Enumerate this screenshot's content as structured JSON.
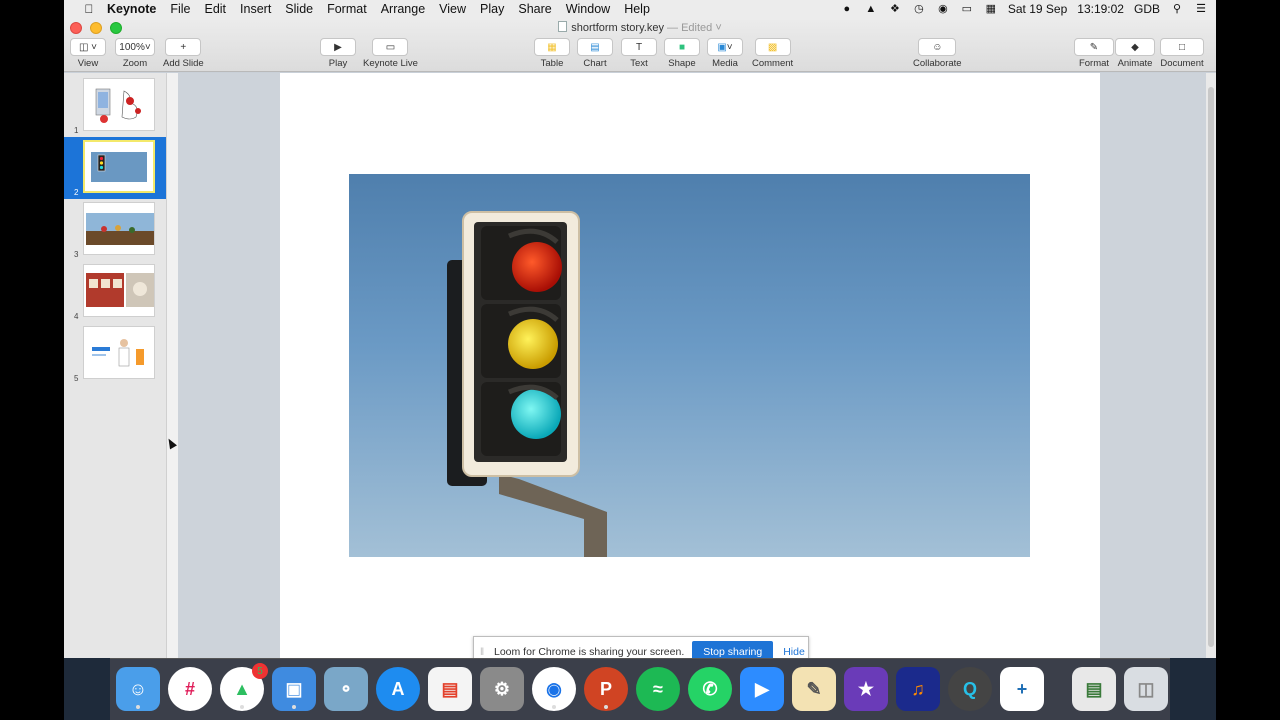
{
  "menubar": {
    "app": "Keynote",
    "items": [
      "File",
      "Edit",
      "Insert",
      "Slide",
      "Format",
      "Arrange",
      "View",
      "Play",
      "Share",
      "Window",
      "Help"
    ],
    "date": "Sat 19 Sep",
    "time": "13:19:02",
    "currency": "GDB"
  },
  "window": {
    "title": "shortform story.key",
    "status": "Edited"
  },
  "toolbar": {
    "view": "View",
    "zoom_value": "100%",
    "zoom": "Zoom",
    "add_slide": "Add Slide",
    "play": "Play",
    "keynote_live": "Keynote Live",
    "table": "Table",
    "chart": "Chart",
    "text": "Text",
    "shape": "Shape",
    "media": "Media",
    "comment": "Comment",
    "collaborate": "Collaborate",
    "format": "Format",
    "animate": "Animate",
    "document": "Document"
  },
  "slides": [
    {
      "num": "1"
    },
    {
      "num": "2"
    },
    {
      "num": "3"
    },
    {
      "num": "4"
    },
    {
      "num": "5"
    }
  ],
  "loom": {
    "message": "Loom for Chrome is sharing your screen.",
    "stop": "Stop sharing",
    "hide": "Hide"
  },
  "dock": {
    "evernote_badge": "5"
  },
  "colors": {
    "selection": "#1c74d8",
    "loom_button": "#1e74d6"
  }
}
